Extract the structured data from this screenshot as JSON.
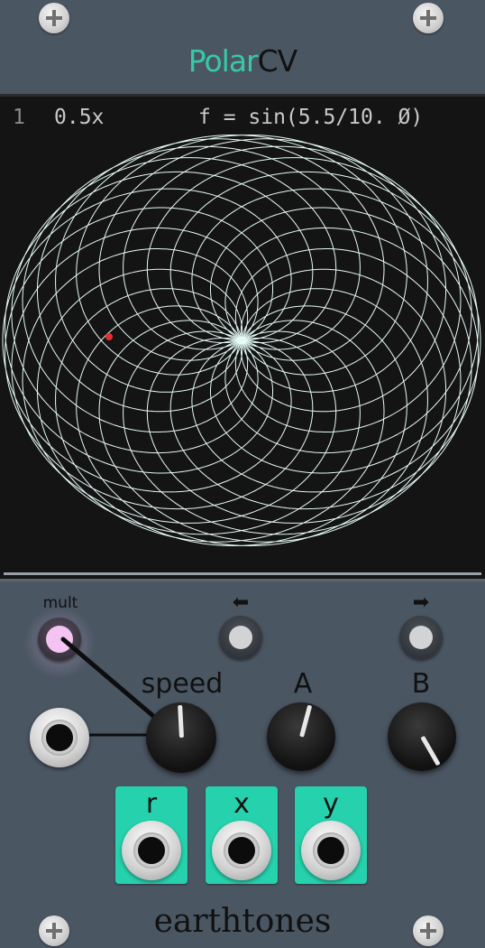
{
  "module": {
    "title_part1": "Polar",
    "title_part2": "CV",
    "brand": "earthtones",
    "colors": {
      "accent": "#37c9a8",
      "panel": "#4b5663",
      "screen": "#141414",
      "tile": "#26d2ad"
    }
  },
  "screen": {
    "index": "1",
    "speed_mult": "0.5x",
    "formula": "f = sin(5.5/10. Ø)"
  },
  "controls": {
    "mult_label": "mult",
    "left_arrow": "⬅",
    "right_arrow": "➡",
    "speed_label": "speed",
    "a_label": "A",
    "b_label": "B"
  },
  "outputs": {
    "r_label": "r",
    "x_label": "x",
    "y_label": "y"
  },
  "icons": [
    "screw-icon",
    "left-arrow-icon",
    "right-arrow-icon",
    "jack-icon",
    "knob-icon"
  ]
}
